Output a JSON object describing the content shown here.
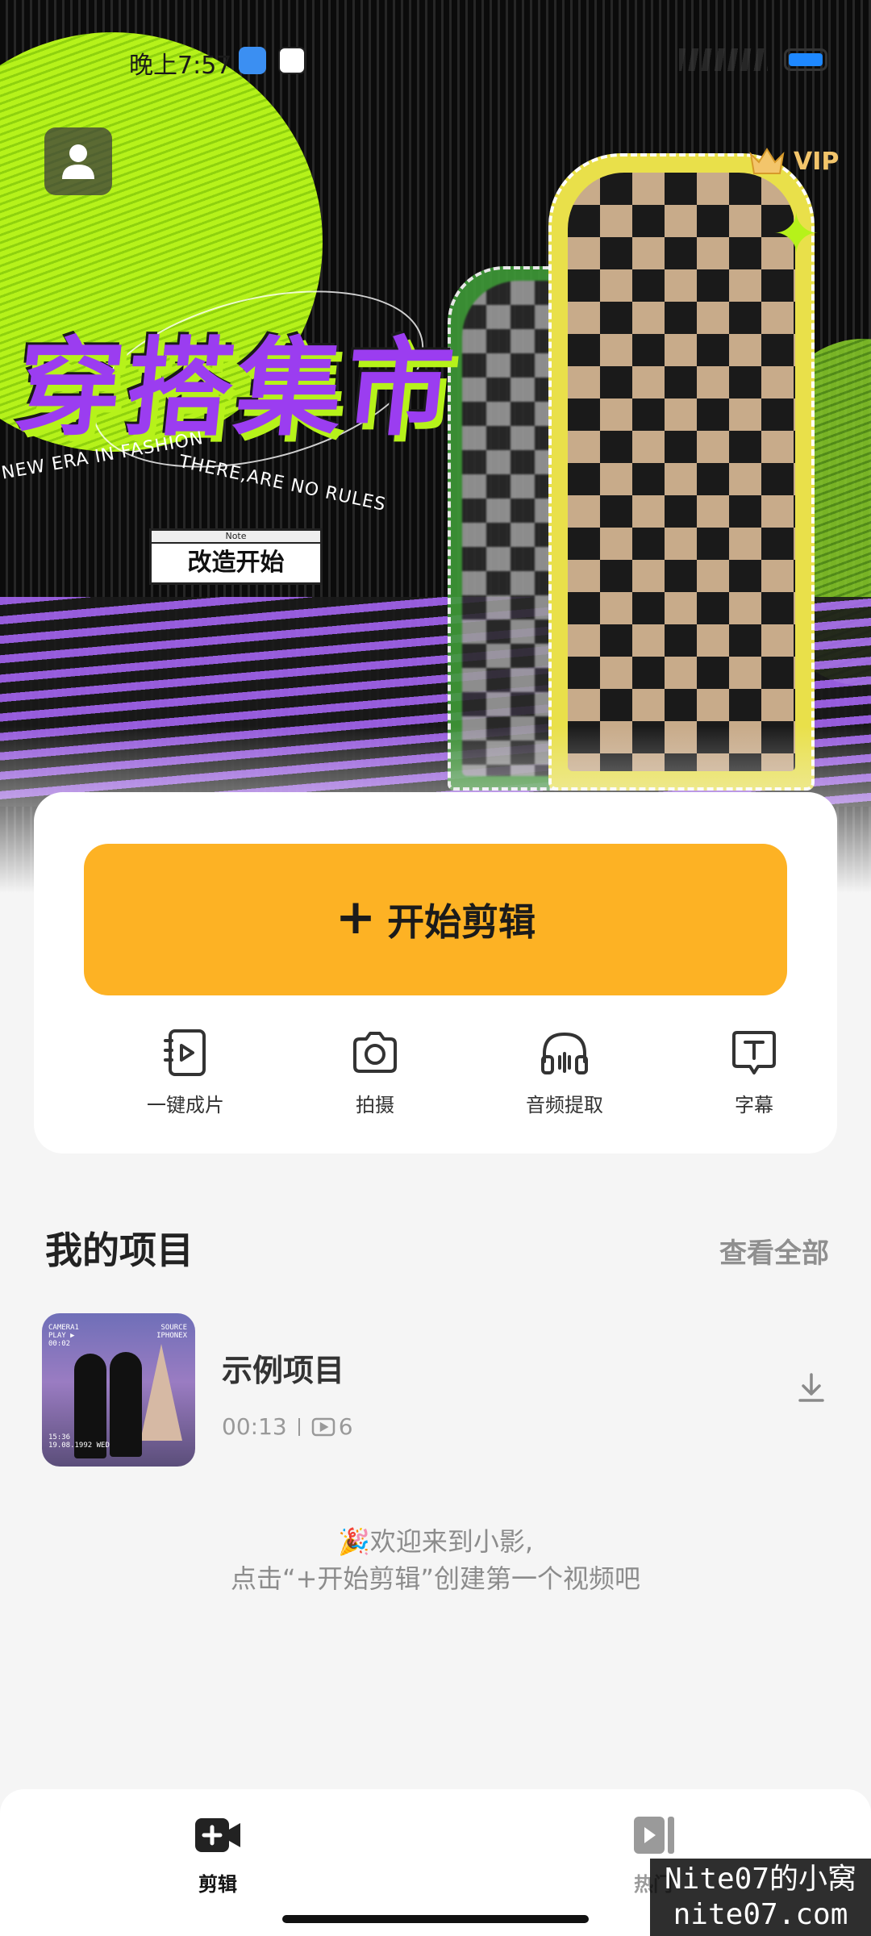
{
  "status_bar": {
    "time": "晚上7:57",
    "battery_color": "#1e88ff"
  },
  "hero": {
    "title": "穿搭集市",
    "tagline_left": "NEW ERA IN FASHION",
    "tagline_right": "THERE,ARE NO RULES",
    "note_header": "Note",
    "note_text": "改造开始",
    "colors": {
      "lime": "#b6f21a",
      "purple": "#9b3df0"
    }
  },
  "header": {
    "avatar_icon": "user-icon",
    "vip_icon": "crown-icon",
    "vip_label": "VIP"
  },
  "action_card": {
    "start_edit_label": "开始剪辑",
    "start_edit_color": "#fdb224",
    "tools": [
      {
        "label": "一键成片",
        "icon": "auto-video-icon"
      },
      {
        "label": "拍摄",
        "icon": "camera-icon"
      },
      {
        "label": "音频提取",
        "icon": "headphones-icon"
      },
      {
        "label": "字幕",
        "icon": "text-icon"
      }
    ]
  },
  "projects": {
    "title": "我的项目",
    "view_all": "查看全部",
    "items": [
      {
        "name": "示例项目",
        "duration": "00:13",
        "clip_count": "6",
        "thumb_text_tl": "CAMERA1\nPLAY ▶\n00:02",
        "thumb_text_tr": "SOURCE\nIPHONEX",
        "thumb_text_bl": "15:36\n19.08.1992 WED"
      }
    ]
  },
  "welcome": {
    "line1": "🎉欢迎来到小影,",
    "line2": "点击“+开始剪辑”创建第一个视频吧"
  },
  "bottom_nav": {
    "items": [
      {
        "label": "剪辑",
        "icon": "add-video-icon",
        "active": true
      },
      {
        "label": "热门",
        "icon": "play-video-icon",
        "active": false
      }
    ]
  },
  "watermark": {
    "line1": "Nite07的小窝",
    "line2": "nite07.com"
  }
}
